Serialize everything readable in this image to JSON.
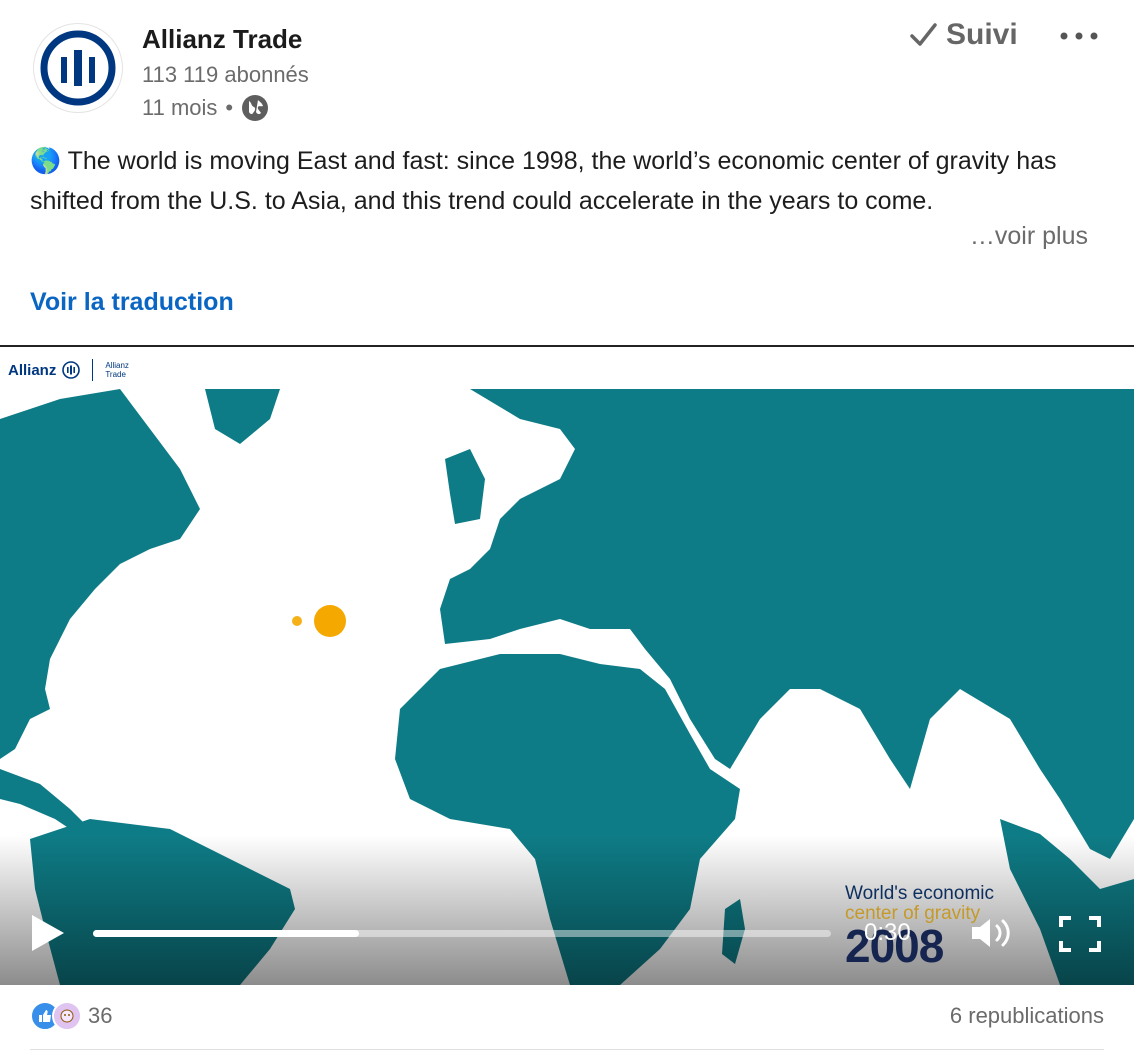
{
  "header": {
    "company_name": "Allianz Trade",
    "followers": "113 119 abonnés",
    "time_ago": "11 mois",
    "dot": "•",
    "follow_label": "Suivi",
    "more_icon": "more-horizontal-icon"
  },
  "post": {
    "text": "🌎 The world is moving East and fast: since 1998, the world’s economic center of gravity has shifted from the U.S. to Asia, and this trend could accelerate in the years to come.",
    "see_more": "…voir plus",
    "translate": "Voir la traduction"
  },
  "video": {
    "brand_main": "Allianz",
    "brand_sub_line1": "Allianz",
    "brand_sub_line2": "Trade",
    "caption_line1": "World's economic",
    "caption_line2": "center of gravity",
    "caption_year": "2008",
    "time": "0:30",
    "progress": 0.36,
    "colors": {
      "map": "#0e7c86",
      "marker": "#f5a800",
      "brand": "#003781"
    }
  },
  "footer": {
    "reaction_count": "36",
    "reposts": "6 republications"
  }
}
